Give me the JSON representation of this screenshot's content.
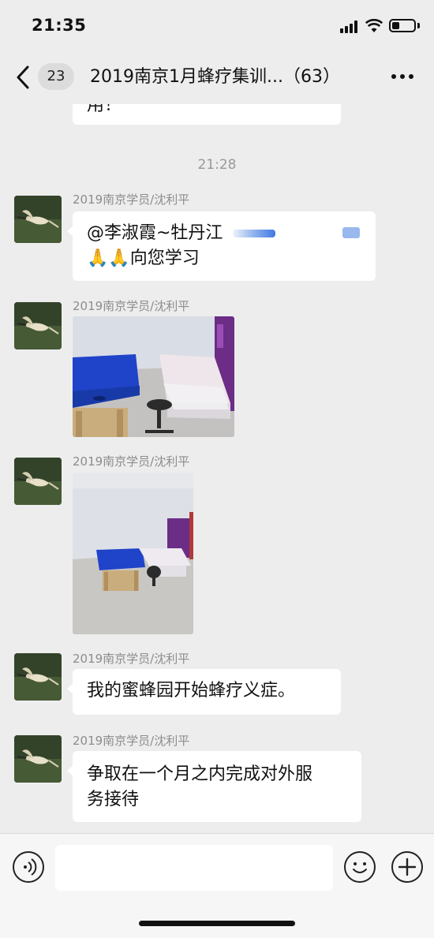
{
  "status": {
    "time": "21:35",
    "battery_level": 0.35
  },
  "nav": {
    "unread_count": "23",
    "title": "2019南京1月蜂疗集训...（63）"
  },
  "chat": {
    "partial_message": "用！",
    "timestamp": "21:28",
    "messages": [
      {
        "sender": "2019南京学员/沈利平",
        "type": "text",
        "line1": "@李淑霞~牡丹江",
        "line2": "🙏🙏向您学习"
      },
      {
        "sender": "2019南京学员/沈利平",
        "type": "image"
      },
      {
        "sender": "2019南京学员/沈利平",
        "type": "image"
      },
      {
        "sender": "2019南京学员/沈利平",
        "type": "text",
        "line1": "我的蜜蜂园开始蜂疗义症。"
      },
      {
        "sender": "2019南京学员/沈利平",
        "type": "text",
        "line1": "争取在一个月之内完成对外服",
        "line2": "务接待"
      }
    ]
  },
  "input": {
    "placeholder": ""
  },
  "icons": {
    "back": "chevron-left-icon",
    "more": "more-dots-icon",
    "voice": "voice-icon",
    "emoji": "emoji-icon",
    "add": "plus-icon"
  },
  "colors": {
    "background": "#ededed",
    "bubble": "#ffffff",
    "massage_table": "#1f43c9"
  }
}
